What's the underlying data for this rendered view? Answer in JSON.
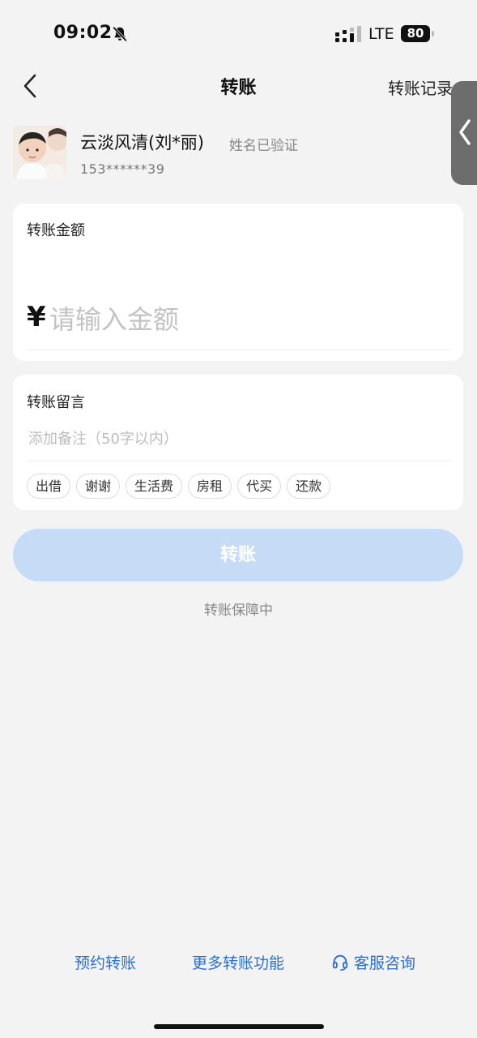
{
  "status_bar": {
    "time": "09:02",
    "network": "LTE",
    "battery": "80"
  },
  "header": {
    "title": "转账",
    "history_label": "转账记录"
  },
  "payee": {
    "name": "云淡风清(刘*丽)",
    "verified_label": "姓名已验证",
    "phone": "153******39"
  },
  "amount": {
    "label": "转账金额",
    "currency": "¥",
    "placeholder": "请输入金额"
  },
  "memo": {
    "label": "转账留言",
    "placeholder": "添加备注（50字以内）",
    "chips": [
      "出借",
      "谢谢",
      "生活费",
      "房租",
      "代买",
      "还款"
    ]
  },
  "submit": {
    "label": "转账"
  },
  "guarantee_text": "转账保障中",
  "bottom_links": {
    "scheduled": "预约转账",
    "more": "更多转账功能",
    "support": "客服咨询"
  },
  "colors": {
    "accent": "#2f6fd0",
    "button_disabled": "#c6dbf6",
    "background": "#f3f3f3"
  },
  "icons": [
    "bell-slash-icon",
    "signal-icon",
    "back-chevron-icon",
    "side-handle-chevron-icon",
    "headset-icon"
  ]
}
